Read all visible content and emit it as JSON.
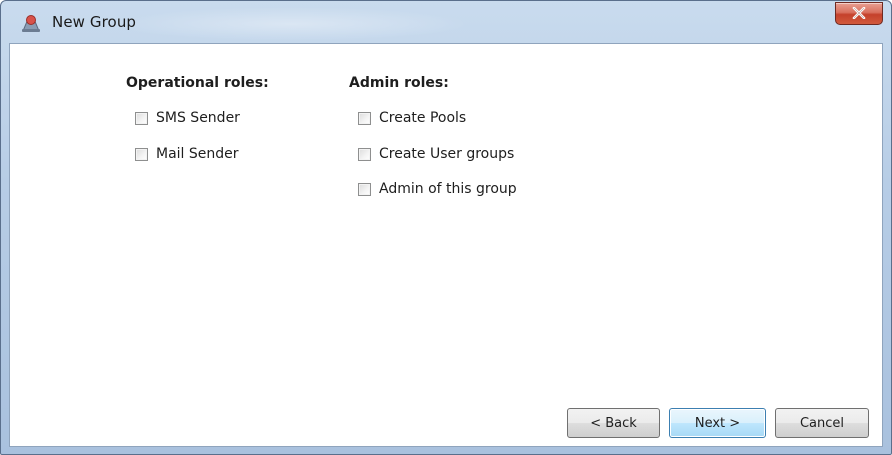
{
  "window": {
    "title": "New Group",
    "close_glyph": "✕"
  },
  "operational": {
    "heading": "Operational roles:",
    "items": [
      {
        "label": "SMS Sender",
        "checked": false
      },
      {
        "label": "Mail Sender",
        "checked": false
      }
    ]
  },
  "admin": {
    "heading": "Admin roles:",
    "items": [
      {
        "label": "Create Pools",
        "checked": false
      },
      {
        "label": "Create User groups",
        "checked": false
      },
      {
        "label": "Admin of this group",
        "checked": false
      }
    ]
  },
  "buttons": {
    "back": "< Back",
    "next": "Next >",
    "cancel": "Cancel"
  },
  "colors": {
    "frame": "#b7cde6",
    "close": "#c4412b",
    "default_button_border": "#3c7fb1"
  }
}
